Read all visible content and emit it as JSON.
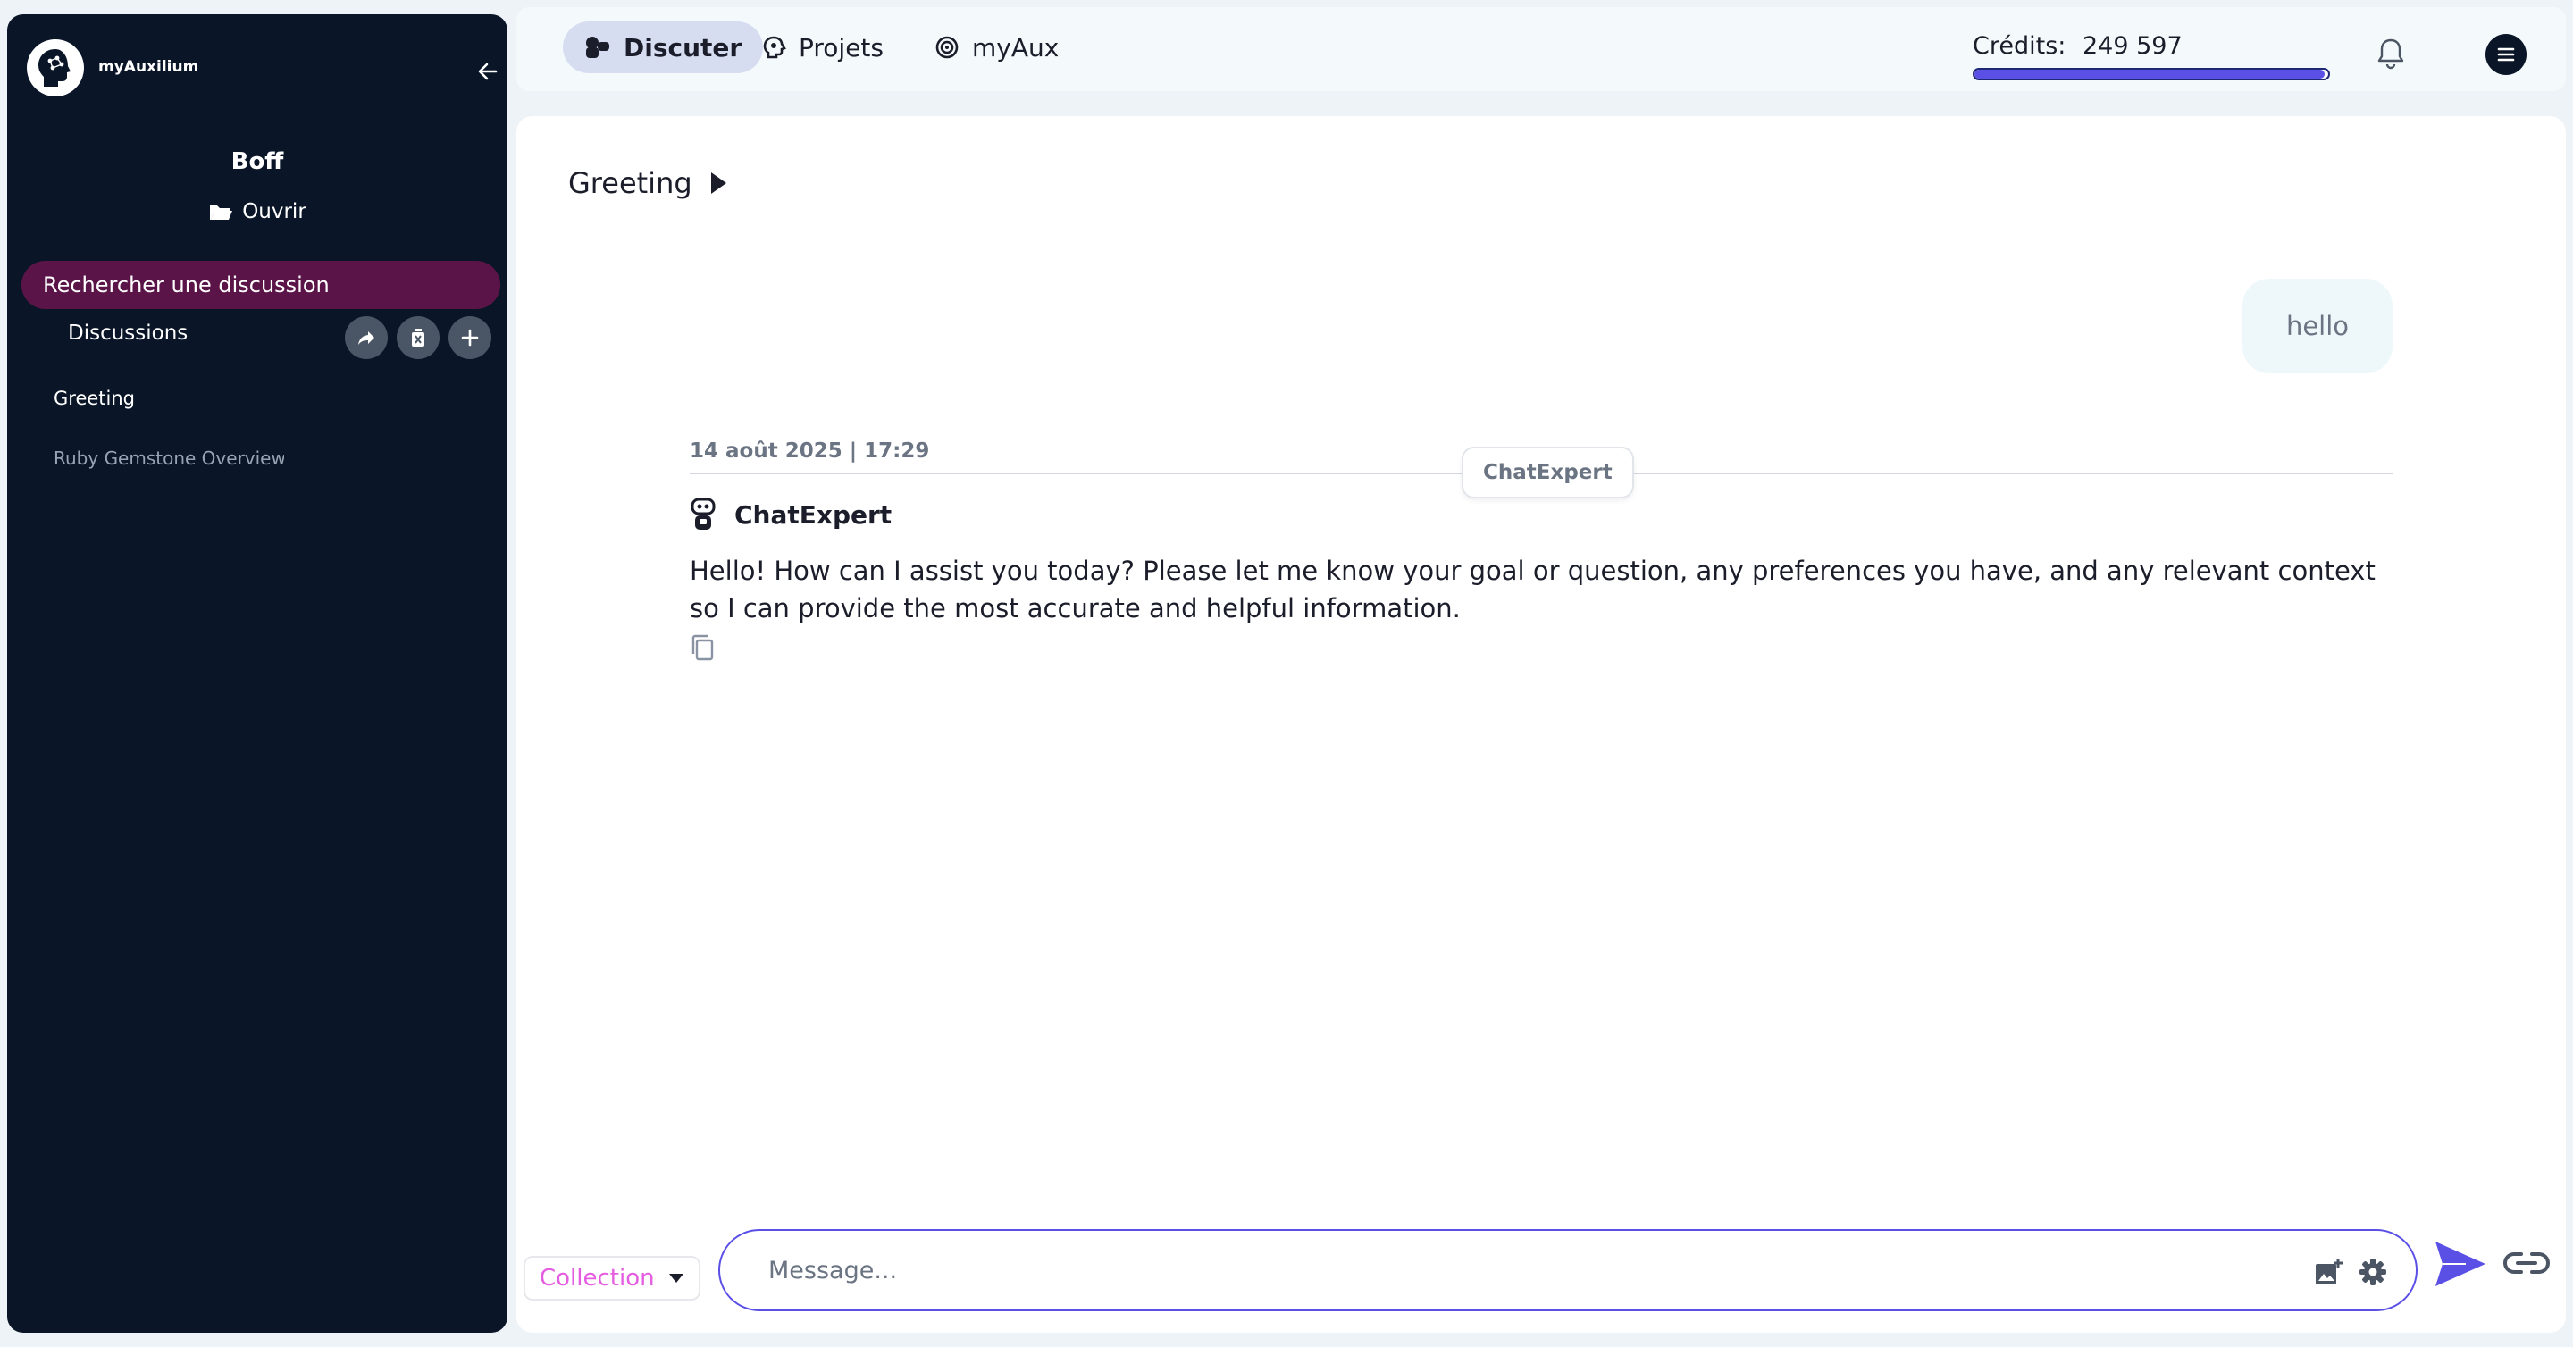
{
  "app": {
    "brand": "myAuxilium"
  },
  "sidebar": {
    "user_name": "Boff",
    "open_label": "Ouvrir",
    "search_label": "Rechercher une discussion",
    "discussions_label": "Discussions",
    "conversations": [
      {
        "label": "Greeting"
      },
      {
        "label": "Ruby Gemstone Overview"
      }
    ]
  },
  "topbar": {
    "tabs": [
      {
        "label": "Discuter",
        "icon": "chat-icon",
        "active": true
      },
      {
        "label": "Projets",
        "icon": "head-icon",
        "active": false
      },
      {
        "label": "myAux",
        "icon": "target-icon",
        "active": false
      }
    ],
    "credits_label": "Crédits:",
    "credits_value": "249 597",
    "credits_fill_fraction": 0.99
  },
  "conversation": {
    "title": "Greeting",
    "user_message": "hello",
    "meta": "14 août 2025 | 17:29",
    "model_chip": "ChatExpert",
    "bot_name": "ChatExpert",
    "bot_message": "Hello! How can I assist you today? Please let me know your goal or question, any preferences you have, and any relevant context so I can provide the most accurate and helpful information."
  },
  "composer": {
    "collection_label": "Collection",
    "placeholder": "Message..."
  },
  "colors": {
    "sidebar_bg": "#0a1628",
    "search_active": "#5a1448",
    "accent": "#5b50e6",
    "collection_text": "#e45de0"
  }
}
